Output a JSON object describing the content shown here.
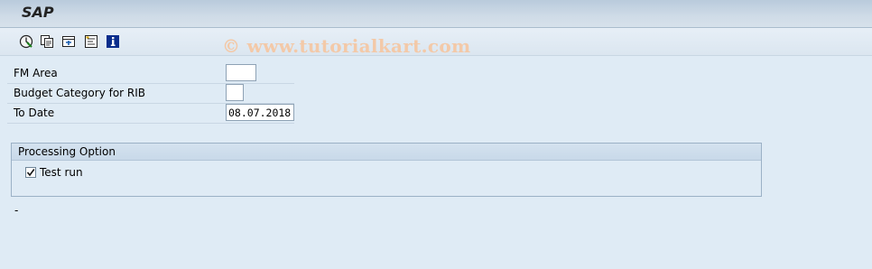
{
  "app": {
    "title": "SAP"
  },
  "toolbar": {
    "buttons": [
      {
        "icon": "execute-icon"
      },
      {
        "icon": "save-variant-icon"
      },
      {
        "icon": "get-variant-icon"
      },
      {
        "icon": "selection-options-icon"
      },
      {
        "icon": "info-icon"
      }
    ]
  },
  "watermark": "© www.tutorialkart.com",
  "form": {
    "fm_area": {
      "label": "FM Area",
      "value": ""
    },
    "budget_category": {
      "label": "Budget Category for RIB",
      "value": ""
    },
    "to_date": {
      "label": "To Date",
      "value": "08.07.2018"
    }
  },
  "processing": {
    "title": "Processing Option",
    "test_run": {
      "label": "Test run",
      "checked": true
    }
  },
  "status_line": "-"
}
